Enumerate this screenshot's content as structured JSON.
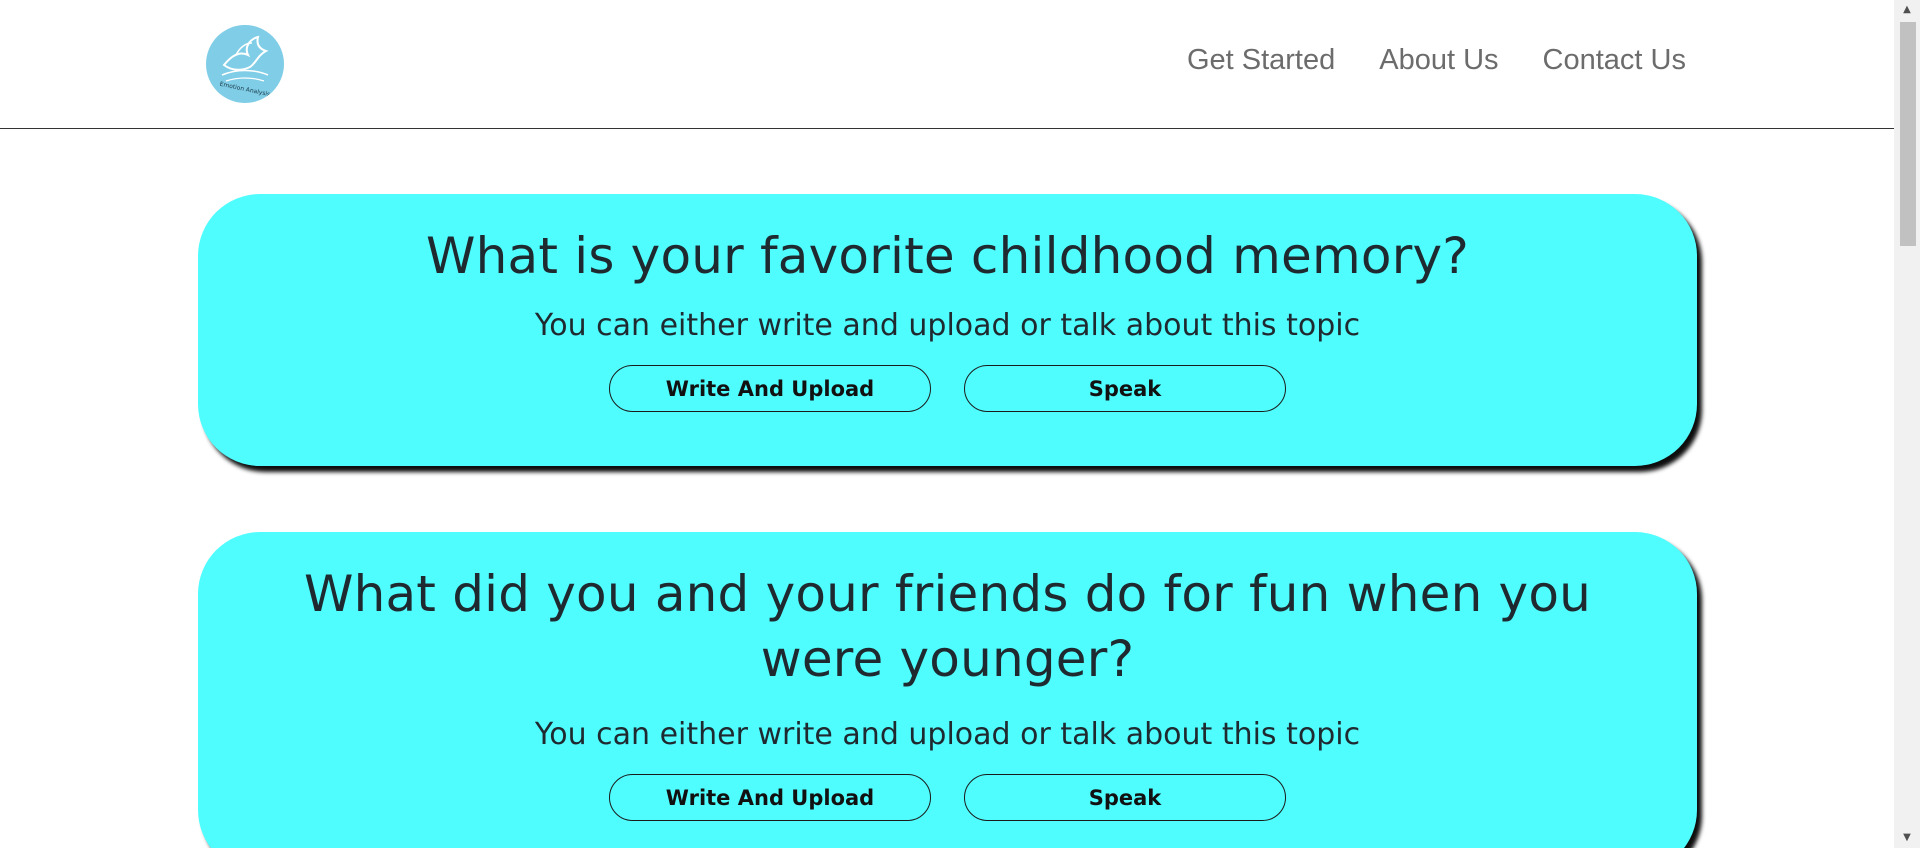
{
  "logo": {
    "text": "Emotion Analysis",
    "icon": "dove-logo-icon",
    "color": "#7fcde6"
  },
  "nav": {
    "items": [
      {
        "label": "Get Started"
      },
      {
        "label": "About Us"
      },
      {
        "label": "Contact Us"
      }
    ]
  },
  "topics": [
    {
      "question": "What is your favorite childhood memory?",
      "subtitle": "You can either write and upload or talk about this topic",
      "write_label": "Write And Upload",
      "speak_label": "Speak"
    },
    {
      "question": "What did you and your friends do for fun when you were younger?",
      "subtitle": "You can either write and upload or talk about this topic",
      "write_label": "Write And Upload",
      "speak_label": "Speak"
    }
  ],
  "colors": {
    "card_background": "#4ffdff",
    "nav_text": "#6c6c6c"
  }
}
